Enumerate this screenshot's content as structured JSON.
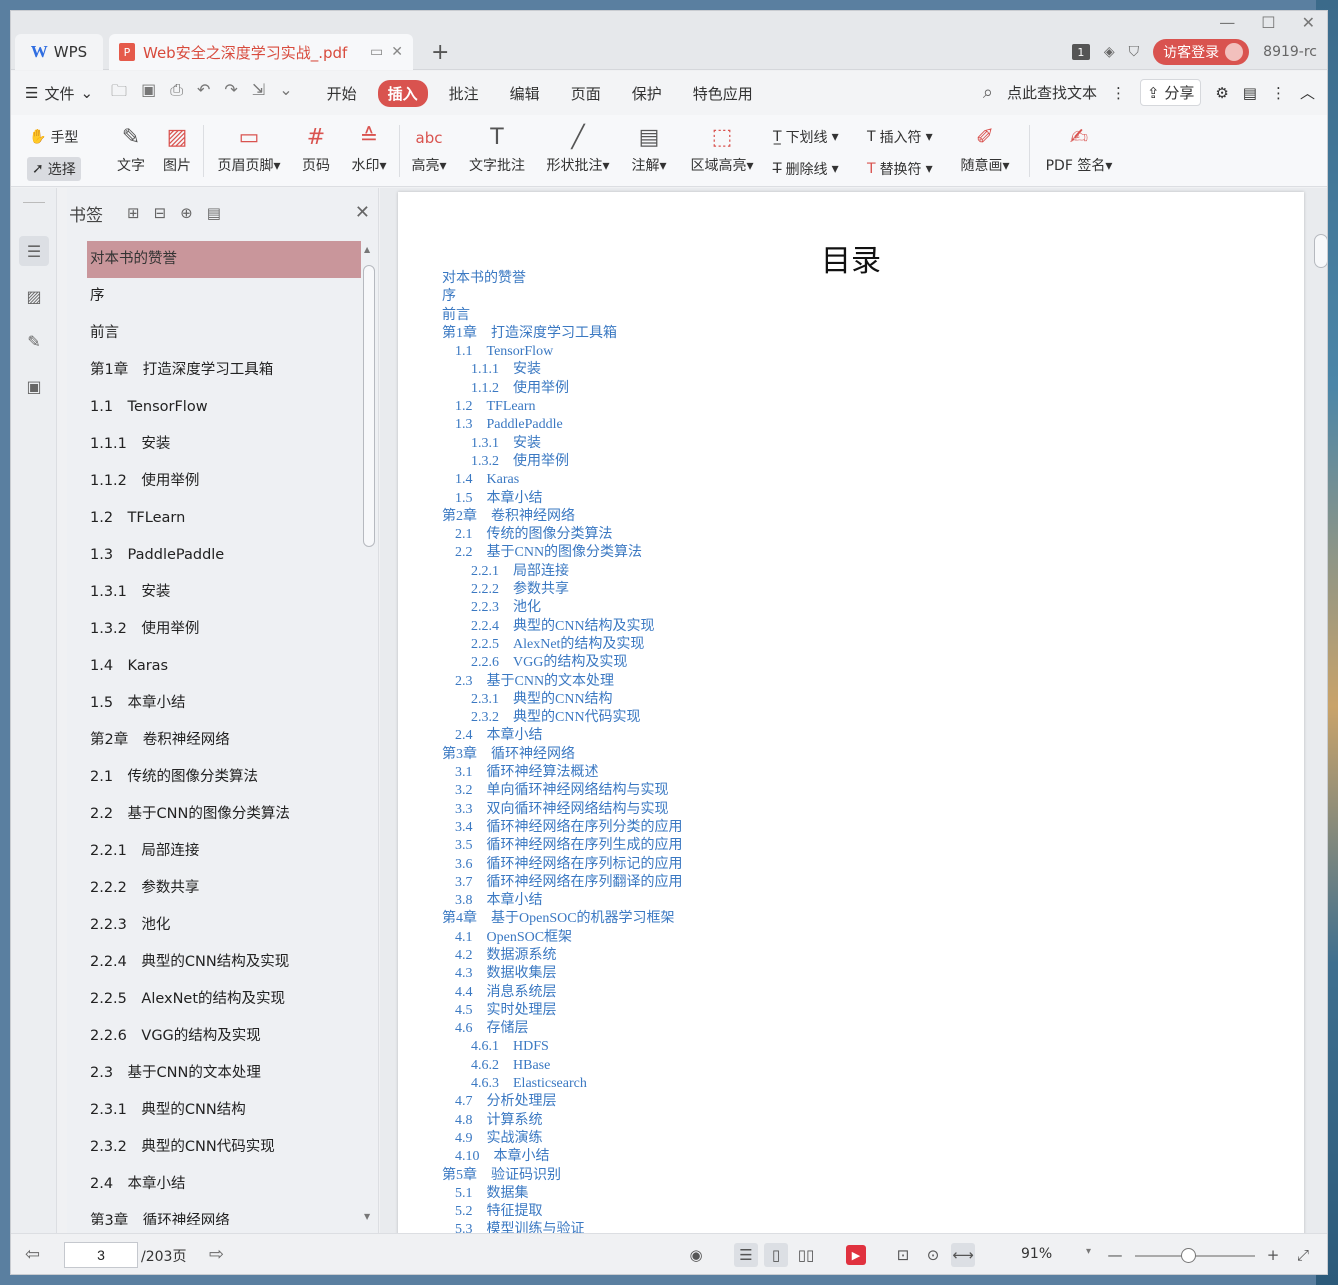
{
  "titlebar": {
    "wps_tab": "WPS",
    "doc_tab": "Web安全之深度学习实战_.pdf",
    "page_badge": "1",
    "visitor_login": "访客登录",
    "version": "8919-rc"
  },
  "menubar": {
    "file": "文件",
    "menus": [
      "开始",
      "插入",
      "批注",
      "编辑",
      "页面",
      "保护",
      "特色应用"
    ],
    "active_menu": "插入",
    "search_placeholder": "点此查找文本",
    "share": "分享"
  },
  "ribbon": {
    "hand": "手型",
    "select": "选择",
    "text": "文字",
    "image": "图片",
    "header_footer": "页眉页脚",
    "page_number": "页码",
    "watermark": "水印",
    "highlight": "高亮",
    "text_comment": "文字批注",
    "shape_comment": "形状批注",
    "annotation": "注解",
    "area_highlight": "区域高亮",
    "underline": "下划线",
    "strikethrough": "删除线",
    "insert_mark": "插入符",
    "replace_mark": "替换符",
    "freehand": "随意画",
    "pdf_sign": "PDF 签名"
  },
  "bookmarks": {
    "title": "书签",
    "items": [
      "对本书的赞誉",
      "序",
      "前言",
      "第1章　打造深度学习工具箱",
      "1.1　TensorFlow",
      "1.1.1　安装",
      "1.1.2　使用举例",
      "1.2　TFLearn",
      "1.3　PaddlePaddle",
      "1.3.1　安装",
      "1.3.2　使用举例",
      "1.4　Karas",
      "1.5　本章小结",
      "第2章　卷积神经网络",
      "2.1　传统的图像分类算法",
      "2.2　基于CNN的图像分类算法",
      "2.2.1　局部连接",
      "2.2.2　参数共享",
      "2.2.3　池化",
      "2.2.4　典型的CNN结构及实现",
      "2.2.5　AlexNet的结构及实现",
      "2.2.6　VGG的结构及实现",
      "2.3　基于CNN的文本处理",
      "2.3.1　典型的CNN结构",
      "2.3.2　典型的CNN代码实现",
      "2.4　本章小结",
      "第3章　循环神经网络"
    ]
  },
  "document": {
    "heading": "目录",
    "toc": [
      {
        "level": 0,
        "text": "对本书的赞誉"
      },
      {
        "level": 0,
        "text": "序"
      },
      {
        "level": 0,
        "text": "前言"
      },
      {
        "level": 0,
        "text": "第1章　打造深度学习工具箱"
      },
      {
        "level": 1,
        "text": "1.1　TensorFlow"
      },
      {
        "level": 2,
        "text": "1.1.1　安装"
      },
      {
        "level": 2,
        "text": "1.1.2　使用举例"
      },
      {
        "level": 1,
        "text": "1.2　TFLearn"
      },
      {
        "level": 1,
        "text": "1.3　PaddlePaddle"
      },
      {
        "level": 2,
        "text": "1.3.1　安装"
      },
      {
        "level": 2,
        "text": "1.3.2　使用举例"
      },
      {
        "level": 1,
        "text": "1.4　Karas"
      },
      {
        "level": 1,
        "text": "1.5　本章小结"
      },
      {
        "level": 0,
        "text": "第2章　卷积神经网络"
      },
      {
        "level": 1,
        "text": "2.1　传统的图像分类算法"
      },
      {
        "level": 1,
        "text": "2.2　基于CNN的图像分类算法"
      },
      {
        "level": 2,
        "text": "2.2.1　局部连接"
      },
      {
        "level": 2,
        "text": "2.2.2　参数共享"
      },
      {
        "level": 2,
        "text": "2.2.3　池化"
      },
      {
        "level": 2,
        "text": "2.2.4　典型的CNN结构及实现"
      },
      {
        "level": 2,
        "text": "2.2.5　AlexNet的结构及实现"
      },
      {
        "level": 2,
        "text": "2.2.6　VGG的结构及实现"
      },
      {
        "level": 1,
        "text": "2.3　基于CNN的文本处理"
      },
      {
        "level": 2,
        "text": "2.3.1　典型的CNN结构"
      },
      {
        "level": 2,
        "text": "2.3.2　典型的CNN代码实现"
      },
      {
        "level": 1,
        "text": "2.4　本章小结"
      },
      {
        "level": 0,
        "text": "第3章　循环神经网络"
      },
      {
        "level": 1,
        "text": "3.1　循环神经算法概述"
      },
      {
        "level": 1,
        "text": "3.2　单向循环神经网络结构与实现"
      },
      {
        "level": 1,
        "text": "3.3　双向循环神经网络结构与实现"
      },
      {
        "level": 1,
        "text": "3.4　循环神经网络在序列分类的应用"
      },
      {
        "level": 1,
        "text": "3.5　循环神经网络在序列生成的应用"
      },
      {
        "level": 1,
        "text": "3.6　循环神经网络在序列标记的应用"
      },
      {
        "level": 1,
        "text": "3.7　循环神经网络在序列翻译的应用"
      },
      {
        "level": 1,
        "text": "3.8　本章小结"
      },
      {
        "level": 0,
        "text": "第4章　基于OpenSOC的机器学习框架"
      },
      {
        "level": 1,
        "text": "4.1　OpenSOC框架"
      },
      {
        "level": 1,
        "text": "4.2　数据源系统"
      },
      {
        "level": 1,
        "text": "4.3　数据收集层"
      },
      {
        "level": 1,
        "text": "4.4　消息系统层"
      },
      {
        "level": 1,
        "text": "4.5　实时处理层"
      },
      {
        "level": 1,
        "text": "4.6　存储层"
      },
      {
        "level": 2,
        "text": "4.6.1　HDFS"
      },
      {
        "level": 2,
        "text": "4.6.2　HBase"
      },
      {
        "level": 2,
        "text": "4.6.3　Elasticsearch"
      },
      {
        "level": 1,
        "text": "4.7　分析处理层"
      },
      {
        "level": 1,
        "text": "4.8　计算系统"
      },
      {
        "level": 1,
        "text": "4.9　实战演练"
      },
      {
        "level": 1,
        "text": "4.10　本章小结"
      },
      {
        "level": 0,
        "text": "第5章　验证码识别"
      },
      {
        "level": 1,
        "text": "5.1　数据集"
      },
      {
        "level": 1,
        "text": "5.2　特征提取"
      },
      {
        "level": 1,
        "text": "5.3　模型训练与验证"
      }
    ]
  },
  "statusbar": {
    "current_page": "3",
    "total_pages": "/203页",
    "zoom": "91%",
    "zoom_fraction": 0.45
  }
}
